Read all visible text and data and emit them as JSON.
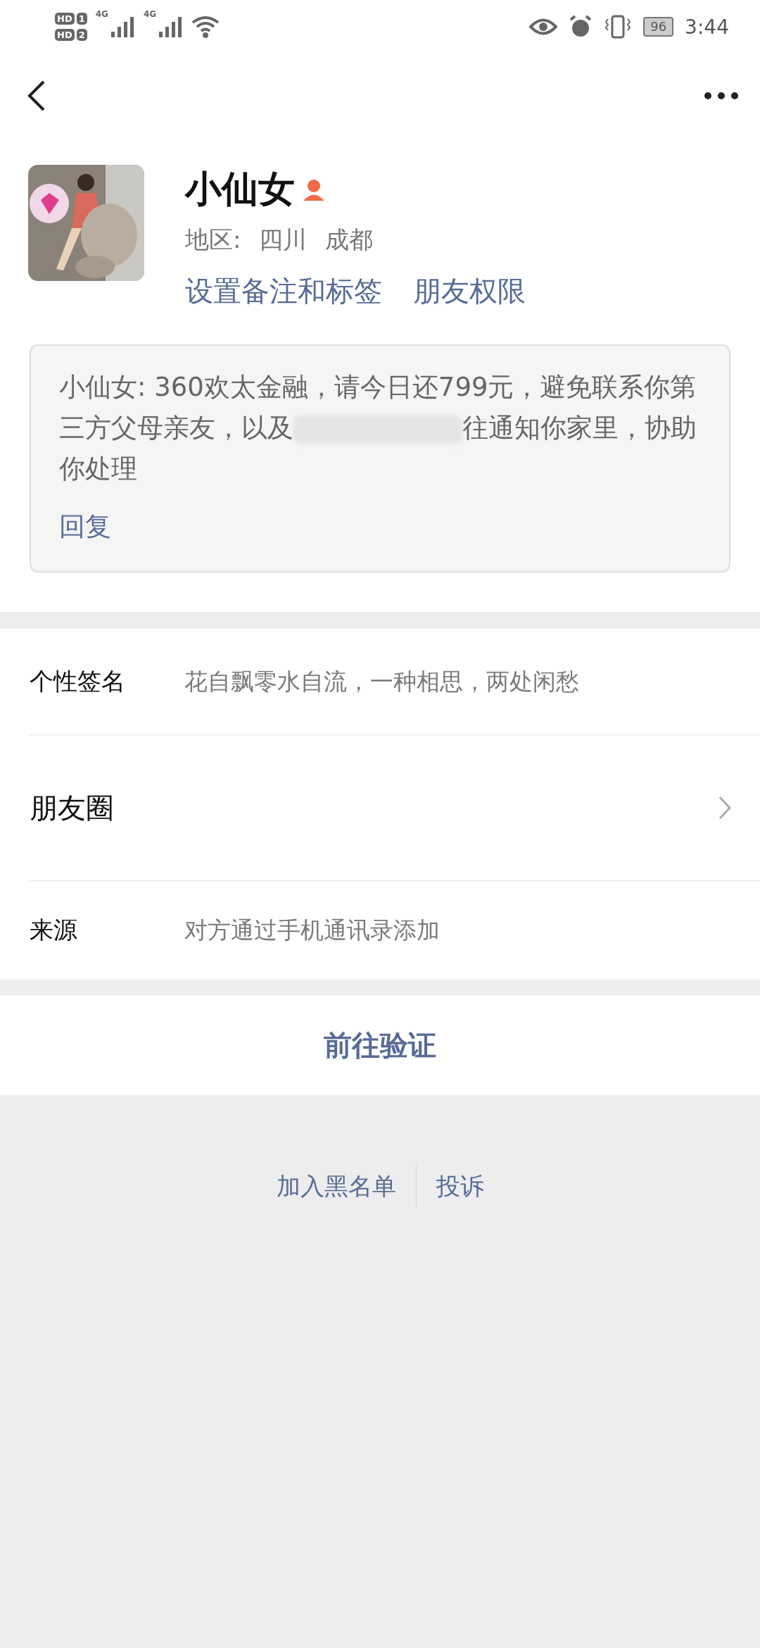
{
  "status_bar": {
    "sim_labels": [
      "HD",
      "HD"
    ],
    "sim_numbers": [
      "1",
      "2"
    ],
    "network": [
      "4G",
      "4G"
    ],
    "battery": "96",
    "time": "3:44"
  },
  "profile": {
    "name": "小仙女",
    "region_label": "地区:",
    "province": "四川",
    "city": "成都",
    "links": [
      "设置备注和标签",
      "朋友权限"
    ]
  },
  "message": {
    "text_before": "小仙女: 360欢太金融，请今日还799元，避免联系你第三方父母亲友，以及",
    "text_after": "往通知你家里，协助你处理",
    "reply": "回复"
  },
  "info_rows": [
    {
      "kind": "text",
      "label": "个性签名",
      "value": "花自飘零水自流，一种相思，两处闲愁"
    },
    {
      "kind": "link",
      "label": "朋友圈"
    },
    {
      "kind": "text",
      "label": "来源",
      "value": "对方通过手机通讯录添加"
    }
  ],
  "action_button": "前往验证",
  "footer_links": [
    "加入黑名单",
    "投诉"
  ]
}
